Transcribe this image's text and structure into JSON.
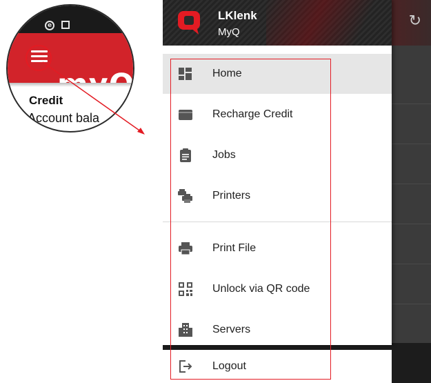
{
  "zoom": {
    "logo_text": "myQ",
    "credit_title": "Credit",
    "credit_subtitle": "Account bala"
  },
  "drawer": {
    "user_name": "LKlenk",
    "organization": "MyQ",
    "items_main": [
      {
        "label": "Home",
        "icon": "dashboard-icon",
        "active": true
      },
      {
        "label": "Recharge Credit",
        "icon": "credit-card-icon",
        "active": false
      },
      {
        "label": "Jobs",
        "icon": "clipboard-icon",
        "active": false
      },
      {
        "label": "Printers",
        "icon": "printers-icon",
        "active": false
      }
    ],
    "items_secondary": [
      {
        "label": "Print File",
        "icon": "printer-icon"
      },
      {
        "label": "Unlock via QR code",
        "icon": "qr-code-icon"
      },
      {
        "label": "Servers",
        "icon": "building-icon"
      }
    ],
    "logout_label": "Logout"
  },
  "colors": {
    "brand_red": "#d2232a",
    "highlight_red": "#e31b23",
    "active_item_bg": "#e6e6e6"
  }
}
